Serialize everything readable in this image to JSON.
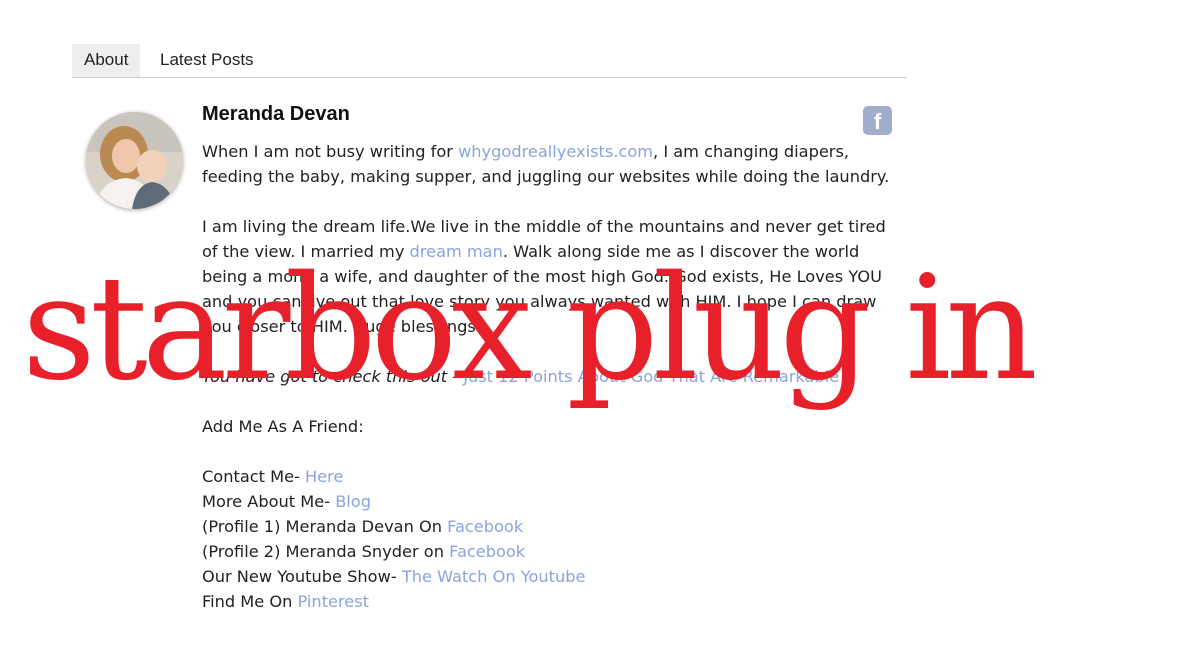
{
  "tabs": [
    {
      "label": "About",
      "active": true
    },
    {
      "label": "Latest Posts",
      "active": false
    }
  ],
  "author": {
    "name": "Meranda Devan",
    "social_icon": "facebook-icon",
    "social_glyph": "f"
  },
  "bio": {
    "p1_a": "When I am not busy writing for ",
    "p1_link": "whygodreallyexists.com",
    "p1_b": ", I am changing diapers, feeding the baby, making supper, and juggling our websites while doing the laundry.",
    "p2_a": "I am living the dream life.We live in the middle of the mountains and never get tired of the view. I married my ",
    "p2_link": "dream man",
    "p2_b": ". Walk along side me as I discover the world being a mom, a wife, and daughter of the most high God. God exists, He Loves YOU and you can live out that love story you always wanted with HIM. I hope I can draw you closer to HIM. Huge blessings!",
    "p3_italic": "You have got to check this out - ",
    "p3_link": "Just 12 Points About God That Are Remarkable",
    "friend_heading": "Add Me As A Friend:",
    "links": [
      {
        "text": "Contact Me- ",
        "link": "Here"
      },
      {
        "text": "More About Me- ",
        "link": "Blog"
      },
      {
        "text": "(Profile 1) Meranda Devan On ",
        "link": "Facebook"
      },
      {
        "text": "(Profile 2) Meranda Snyder on ",
        "link": "Facebook"
      },
      {
        "text": "Our New Youtube Show- ",
        "link": "The Watch On Youtube"
      },
      {
        "text": "Find Me On ",
        "link": "Pinterest"
      }
    ]
  },
  "overlay_text": "starbox plug in",
  "colors": {
    "link": "#8aa4dd",
    "overlay": "#e8202a",
    "facebook_button": "#a1aecb",
    "active_tab": "#eeeeee"
  }
}
